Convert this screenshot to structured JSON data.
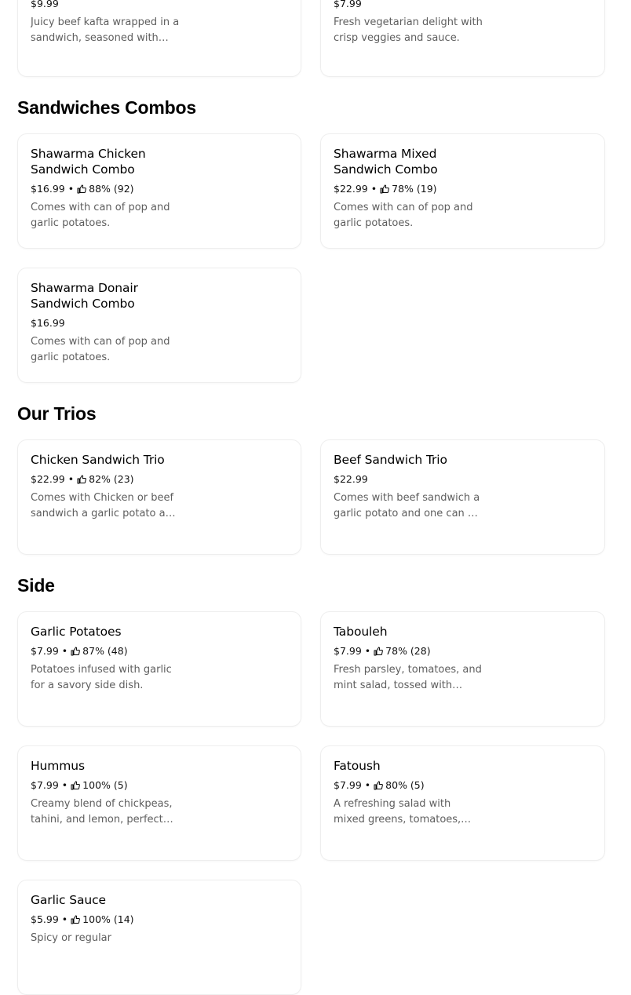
{
  "partial_top": {
    "left": {
      "price": "$9.99",
      "description": "Juicy beef kafta wrapped in a sandwich, seasoned with herbs and spices."
    },
    "right": {
      "price": "$7.99",
      "description": "Fresh vegetarian delight with crisp veggies and sauce."
    }
  },
  "sections": [
    {
      "title": "Sandwiches Combos",
      "items": [
        {
          "name": "Shawarma Chicken Sandwich Combo",
          "price": "$16.99",
          "rating": "88% (92)",
          "description": "Comes with can of pop and garlic potatoes."
        },
        {
          "name": "Shawarma Mixed Sandwich Combo",
          "price": "$22.99",
          "rating": "78% (19)",
          "description": "Comes with can of pop and garlic potatoes."
        },
        {
          "name": "Shawarma Donair Sandwich Combo",
          "price": "$16.99",
          "description": "Comes with can of pop and garlic potatoes."
        }
      ]
    },
    {
      "title": "Our Trios",
      "items": [
        {
          "name": "Chicken Sandwich Trio",
          "price": "$22.99",
          "rating": "82% (23)",
          "description": "Comes with Chicken or beef sandwich a garlic potato and one can of pop."
        },
        {
          "name": "Beef Sandwich Trio",
          "price": "$22.99",
          "description": "Comes with beef sandwich a garlic potato and one can of pop."
        }
      ]
    },
    {
      "title": "Side",
      "items": [
        {
          "name": "Garlic Potatoes",
          "price": "$7.99",
          "rating": "87% (48)",
          "description": "Potatoes infused with garlic for a savory side dish."
        },
        {
          "name": "Tabouleh",
          "price": "$7.99",
          "rating": "78% (28)",
          "description": "Fresh parsley, tomatoes, and mint salad, tossed with lemon."
        },
        {
          "name": "Hummus",
          "price": "$7.99",
          "rating": "100% (5)",
          "description": "Creamy blend of chickpeas, tahini, and lemon, perfect for dipping."
        },
        {
          "name": "Fatoush",
          "price": "$7.99",
          "rating": "80% (5)",
          "description": "A refreshing salad with mixed greens, tomatoes, and pita chips."
        },
        {
          "name": "Garlic Sauce",
          "price": "$5.99",
          "rating": "100% (14)",
          "description": "Spicy or regular"
        }
      ]
    }
  ],
  "separator": "•",
  "icons": {
    "rating": "thumbs-up-icon"
  },
  "colors": {
    "text": "#000000",
    "secondary_text": "#5e5e5e",
    "card_border": "#eeeeee"
  }
}
